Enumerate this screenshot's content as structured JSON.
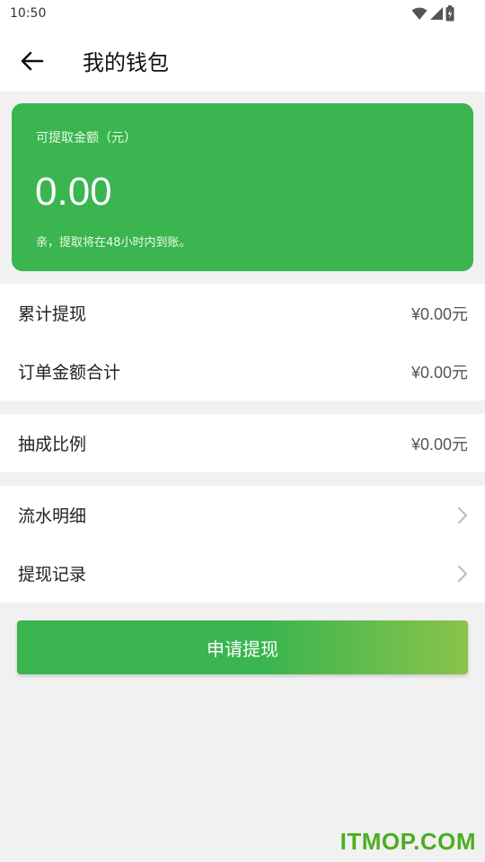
{
  "status": {
    "time": "10:50",
    "icons": [
      "wifi-icon",
      "signal-icon",
      "battery-charging-icon"
    ]
  },
  "header": {
    "title": "我的钱包",
    "back_icon": "arrow-left-icon"
  },
  "balance": {
    "label": "可提取金额（元）",
    "amount": "0.00",
    "note": "亲，提取将在48小时内到账。",
    "color": "#3ab54f"
  },
  "stats": [
    {
      "label": "累计提现",
      "value": "¥0.00元"
    },
    {
      "label": "订单金额合计",
      "value": "¥0.00元"
    }
  ],
  "commission": {
    "label": "抽成比例",
    "value": "¥0.00元"
  },
  "links": [
    {
      "label": "流水明细",
      "icon": "chevron-right-icon"
    },
    {
      "label": "提现记录",
      "icon": "chevron-right-icon"
    }
  ],
  "apply_button": {
    "label": "申请提现"
  },
  "watermark": {
    "text": "ITMOP.COM"
  }
}
